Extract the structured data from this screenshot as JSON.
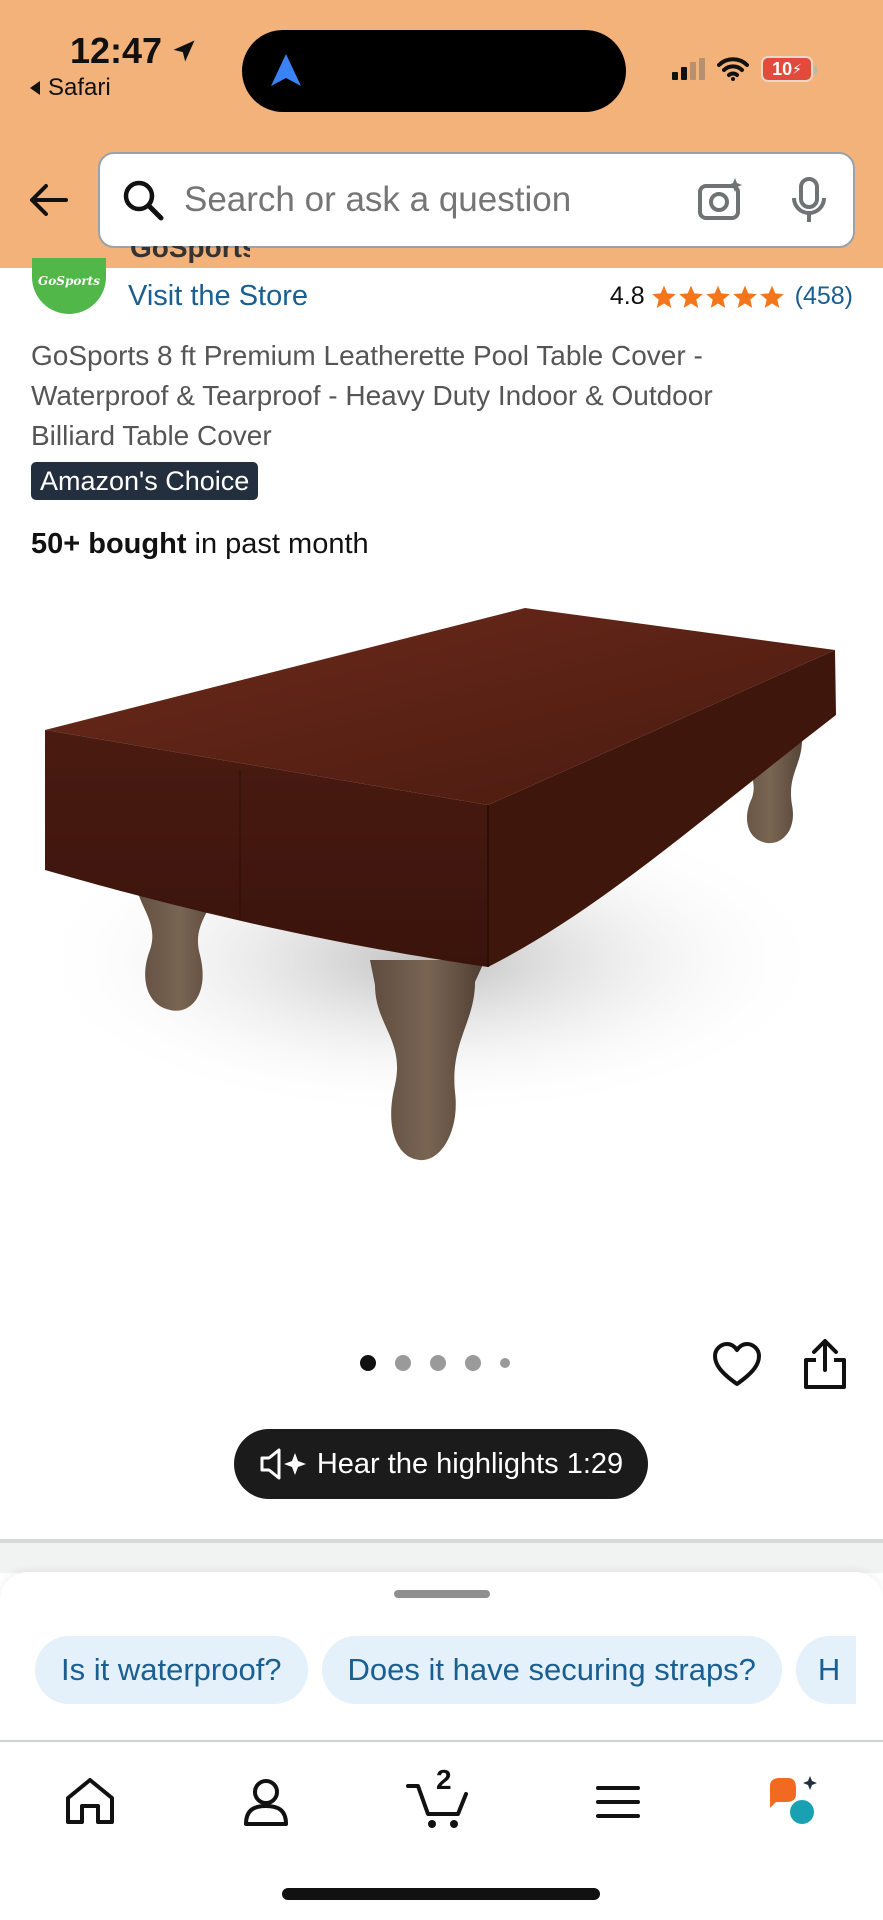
{
  "status_bar": {
    "time": "12:47",
    "back_app": "Safari",
    "battery": "10"
  },
  "search": {
    "placeholder": "Search or ask a question"
  },
  "store": {
    "logo_text": "GoSports",
    "visit_label": "Visit the Store",
    "rating": "4.8",
    "rating_count": "(458)",
    "stars": 5
  },
  "product": {
    "title": "GoSports 8 ft Premium Leatherette Pool Table Cover - Waterproof & Tearproof - Heavy Duty Indoor & Outdoor Billiard Table Cover",
    "badge": "Amazon's Choice",
    "bought_bold": "50+ bought",
    "bought_rest": " in past month",
    "image_count": 5,
    "active_image": 1
  },
  "audio": {
    "label": "Hear the highlights 1:29"
  },
  "rufus": {
    "chips": [
      "Is it waterproof?",
      "Does it have securing straps?",
      "H"
    ]
  },
  "nav": {
    "cart_count": "2",
    "items": [
      "home-icon",
      "account-icon",
      "cart-icon",
      "menu-icon",
      "rufus-icon"
    ]
  },
  "colors": {
    "header_bg": "#f4b27b",
    "link": "#1a5f91",
    "star": "#f3751c",
    "badge_bg": "#232f3e",
    "chip_bg": "#e4f0fa"
  }
}
